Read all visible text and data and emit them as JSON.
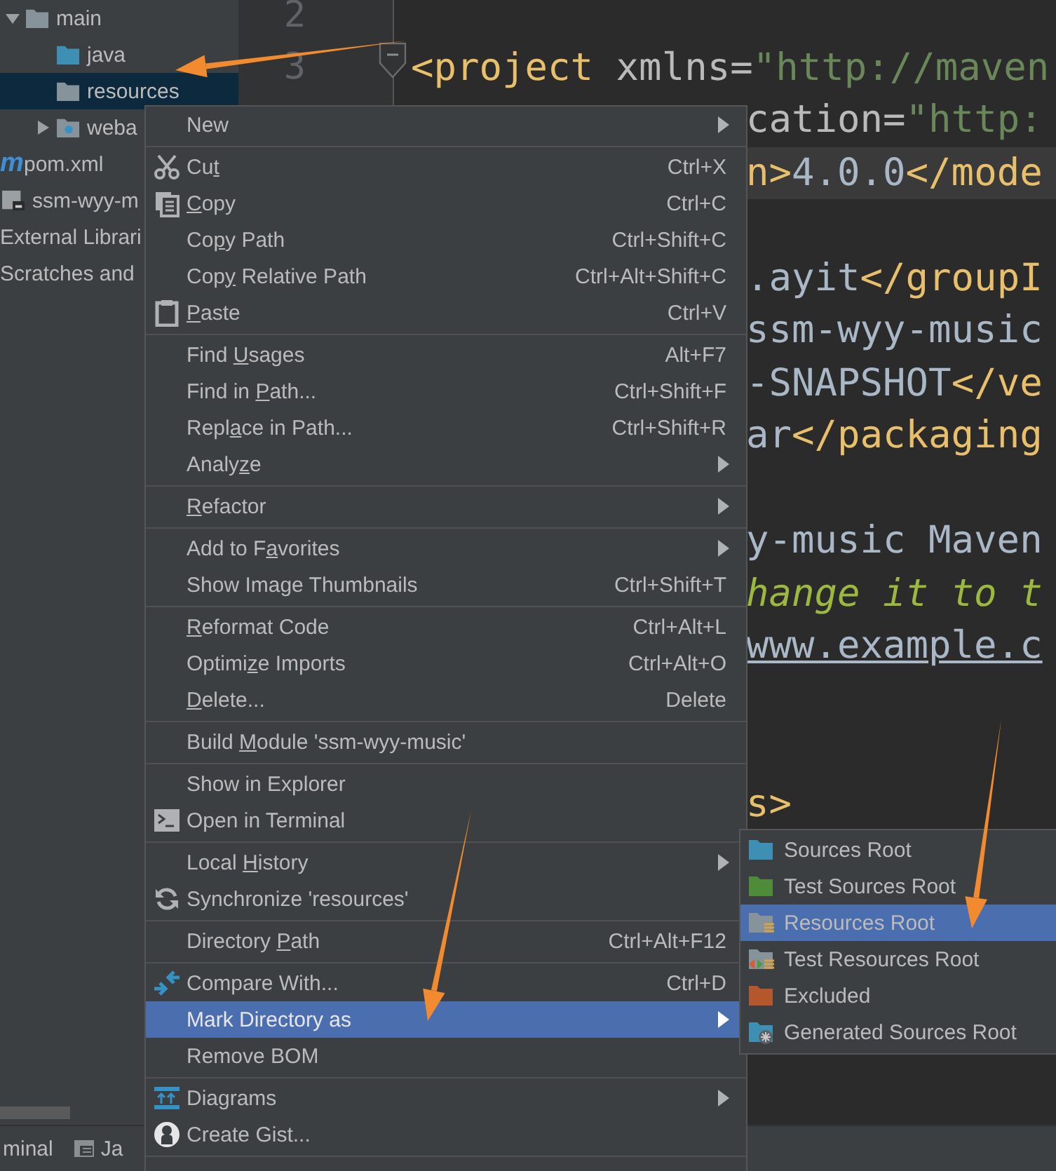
{
  "project_tree": [
    {
      "label": "main",
      "kind": "folder",
      "expanded": true,
      "selected": false,
      "children": [
        {
          "label": "java",
          "kind": "source",
          "selected": false
        },
        {
          "label": "resources",
          "kind": "folder",
          "selected": true
        },
        {
          "label": "weba",
          "kind": "web",
          "expanded": false,
          "selected": false
        }
      ]
    },
    {
      "label": "pom.xml",
      "kind": "maven",
      "icon_text": "m",
      "selected": false
    },
    {
      "label": "ssm-wyy-m",
      "kind": "module",
      "selected": false
    },
    {
      "label": "External Librari",
      "kind": "plain",
      "selected": false
    },
    {
      "label": "Scratches and",
      "kind": "plain",
      "selected": false
    }
  ],
  "editor": {
    "lines": [
      {
        "kind": "blank",
        "number": "2"
      },
      {
        "kind": "code",
        "number": "3",
        "fold": true,
        "segments": [
          {
            "kind": "tag",
            "text": "<project"
          },
          {
            "kind": "attr",
            "text": " xmlns="
          },
          {
            "kind": "string",
            "text": "\"http://maven"
          }
        ]
      },
      {
        "kind": "code",
        "partial": true,
        "segments": [
          {
            "kind": "attr",
            "text": "cation="
          },
          {
            "kind": "string",
            "text": "\"http:"
          }
        ]
      },
      {
        "kind": "code",
        "partial": true,
        "current": true,
        "segments": [
          {
            "kind": "tag",
            "text": "n>"
          },
          {
            "kind": "text",
            "text": "4.0.0"
          },
          {
            "kind": "tag",
            "text": "</mode"
          }
        ]
      },
      {
        "kind": "blank"
      },
      {
        "kind": "code",
        "partial": true,
        "segments": [
          {
            "kind": "text",
            "text": ".ayit"
          },
          {
            "kind": "tag",
            "text": "</groupI"
          }
        ]
      },
      {
        "kind": "code",
        "partial": true,
        "segments": [
          {
            "kind": "text",
            "text": "ssm-wyy-music"
          }
        ]
      },
      {
        "kind": "code",
        "partial": true,
        "segments": [
          {
            "kind": "text",
            "text": "-SNAPSHOT"
          },
          {
            "kind": "tag",
            "text": "</ve"
          }
        ]
      },
      {
        "kind": "code",
        "partial": true,
        "segments": [
          {
            "kind": "text",
            "text": "ar"
          },
          {
            "kind": "tag",
            "text": "</packaging"
          }
        ]
      },
      {
        "kind": "blank"
      },
      {
        "kind": "code",
        "partial": true,
        "segments": [
          {
            "kind": "text",
            "text": "y-music Maven"
          }
        ]
      },
      {
        "kind": "code",
        "partial": true,
        "segments": [
          {
            "kind": "comment",
            "text": "hange it to t"
          }
        ]
      },
      {
        "kind": "code",
        "partial": true,
        "segments": [
          {
            "kind": "link",
            "text": "www.example.c"
          }
        ]
      },
      {
        "kind": "blank"
      },
      {
        "kind": "blank"
      },
      {
        "kind": "code",
        "partial": true,
        "segments": [
          {
            "kind": "tag",
            "text": "s>"
          }
        ]
      }
    ]
  },
  "tool_tabs": [
    {
      "label": "minal",
      "kind": "text"
    },
    {
      "label": "Ja",
      "kind": "window"
    }
  ],
  "context_menu": [
    {
      "kind": "item",
      "label": "New",
      "submenu": true,
      "selected": false
    },
    {
      "kind": "separator"
    },
    {
      "kind": "cut",
      "label": [
        {
          "text": "Cu",
          "underlined": false
        },
        {
          "text": "t",
          "underlined": true
        }
      ],
      "shortcut": "Ctrl+X",
      "selected": false
    },
    {
      "kind": "copy",
      "label": [
        {
          "text": "C",
          "underlined": true
        },
        {
          "text": "opy",
          "underlined": false
        }
      ],
      "shortcut": "Ctrl+C",
      "selected": false
    },
    {
      "kind": "item",
      "label": [
        {
          "text": "Co",
          "underlined": false
        },
        {
          "text": "p",
          "underlined": true
        },
        {
          "text": "y Path",
          "underlined": false
        }
      ],
      "shortcut": "Ctrl+Shift+C",
      "selected": false
    },
    {
      "kind": "item",
      "label": [
        {
          "text": "Cop",
          "underlined": false
        },
        {
          "text": "y",
          "underlined": true
        },
        {
          "text": " Relative Path",
          "underlined": false
        }
      ],
      "shortcut": "Ctrl+Alt+Shift+C",
      "selected": false
    },
    {
      "kind": "paste",
      "label": [
        {
          "text": "P",
          "underlined": true
        },
        {
          "text": "aste",
          "underlined": false
        }
      ],
      "shortcut": "Ctrl+V",
      "selected": false
    },
    {
      "kind": "separator"
    },
    {
      "kind": "item",
      "label": [
        {
          "text": "Find ",
          "underlined": false
        },
        {
          "text": "U",
          "underlined": true
        },
        {
          "text": "sages",
          "underlined": false
        }
      ],
      "shortcut": "Alt+F7",
      "selected": false
    },
    {
      "kind": "item",
      "label": [
        {
          "text": "Find in ",
          "underlined": false
        },
        {
          "text": "P",
          "underlined": true
        },
        {
          "text": "ath...",
          "underlined": false
        }
      ],
      "shortcut": "Ctrl+Shift+F",
      "selected": false
    },
    {
      "kind": "item",
      "label": [
        {
          "text": "Repl",
          "underlined": false
        },
        {
          "text": "a",
          "underlined": true
        },
        {
          "text": "ce in Path...",
          "underlined": false
        }
      ],
      "shortcut": "Ctrl+Shift+R",
      "selected": false
    },
    {
      "kind": "item",
      "label": [
        {
          "text": "Analy",
          "underlined": false
        },
        {
          "text": "z",
          "underlined": true
        },
        {
          "text": "e",
          "underlined": false
        }
      ],
      "submenu": true,
      "selected": false
    },
    {
      "kind": "separator"
    },
    {
      "kind": "item",
      "label": [
        {
          "text": "R",
          "underlined": true
        },
        {
          "text": "efactor",
          "underlined": false
        }
      ],
      "submenu": true,
      "selected": false
    },
    {
      "kind": "separator"
    },
    {
      "kind": "item",
      "label": [
        {
          "text": "Add to F",
          "underlined": false
        },
        {
          "text": "a",
          "underlined": true
        },
        {
          "text": "vorites",
          "underlined": false
        }
      ],
      "submenu": true,
      "selected": false
    },
    {
      "kind": "item",
      "label": "Show Image Thumbnails",
      "shortcut": "Ctrl+Shift+T",
      "selected": false
    },
    {
      "kind": "separator"
    },
    {
      "kind": "item",
      "label": [
        {
          "text": "R",
          "underlined": true
        },
        {
          "text": "eformat Code",
          "underlined": false
        }
      ],
      "shortcut": "Ctrl+Alt+L",
      "selected": false
    },
    {
      "kind": "item",
      "label": [
        {
          "text": "Optimi",
          "underlined": false
        },
        {
          "text": "z",
          "underlined": true
        },
        {
          "text": "e Imports",
          "underlined": false
        }
      ],
      "shortcut": "Ctrl+Alt+O",
      "selected": false
    },
    {
      "kind": "item",
      "label": [
        {
          "text": "D",
          "underlined": true
        },
        {
          "text": "elete...",
          "underlined": false
        }
      ],
      "shortcut": "Delete",
      "selected": false
    },
    {
      "kind": "separator"
    },
    {
      "kind": "item",
      "label": [
        {
          "text": "Build ",
          "underlined": false
        },
        {
          "text": "M",
          "underlined": true
        },
        {
          "text": "odule 'ssm-wyy-music'",
          "underlined": false
        }
      ],
      "selected": false
    },
    {
      "kind": "separator"
    },
    {
      "kind": "item",
      "label": "Show in Explorer",
      "selected": false
    },
    {
      "kind": "terminal",
      "label": "Open in Terminal",
      "selected": false
    },
    {
      "kind": "separator"
    },
    {
      "kind": "item",
      "label": [
        {
          "text": "Local ",
          "underlined": false
        },
        {
          "text": "H",
          "underlined": true
        },
        {
          "text": "istory",
          "underlined": false
        }
      ],
      "submenu": true,
      "selected": false
    },
    {
      "kind": "sync",
      "label": "Synchronize 'resources'",
      "selected": false
    },
    {
      "kind": "separator"
    },
    {
      "kind": "item",
      "label": [
        {
          "text": "Directory ",
          "underlined": false
        },
        {
          "text": "P",
          "underlined": true
        },
        {
          "text": "ath",
          "underlined": false
        }
      ],
      "shortcut": "Ctrl+Alt+F12",
      "selected": false
    },
    {
      "kind": "separator"
    },
    {
      "kind": "compare",
      "label": "Compare With...",
      "shortcut": "Ctrl+D",
      "selected": false
    },
    {
      "kind": "item",
      "label": "Mark Directory as",
      "submenu": true,
      "selected": true
    },
    {
      "kind": "item",
      "label": "Remove BOM",
      "selected": false
    },
    {
      "kind": "separator"
    },
    {
      "kind": "diagram",
      "label": "Diagrams",
      "submenu": true,
      "selected": false
    },
    {
      "kind": "gist",
      "label": "Create Gist...",
      "selected": false
    },
    {
      "kind": "separator"
    }
  ],
  "submenu": [
    {
      "label": "Sources Root",
      "kind": "source",
      "selected": false
    },
    {
      "label": "Test Sources Root",
      "kind": "test",
      "selected": false
    },
    {
      "label": "Resources Root",
      "kind": "resource",
      "selected": true
    },
    {
      "label": "Test Resources Root",
      "kind": "testresource",
      "selected": false
    },
    {
      "label": "Excluded",
      "kind": "excluded",
      "selected": false
    },
    {
      "label": "Generated Sources Root",
      "kind": "generated",
      "selected": false
    }
  ]
}
